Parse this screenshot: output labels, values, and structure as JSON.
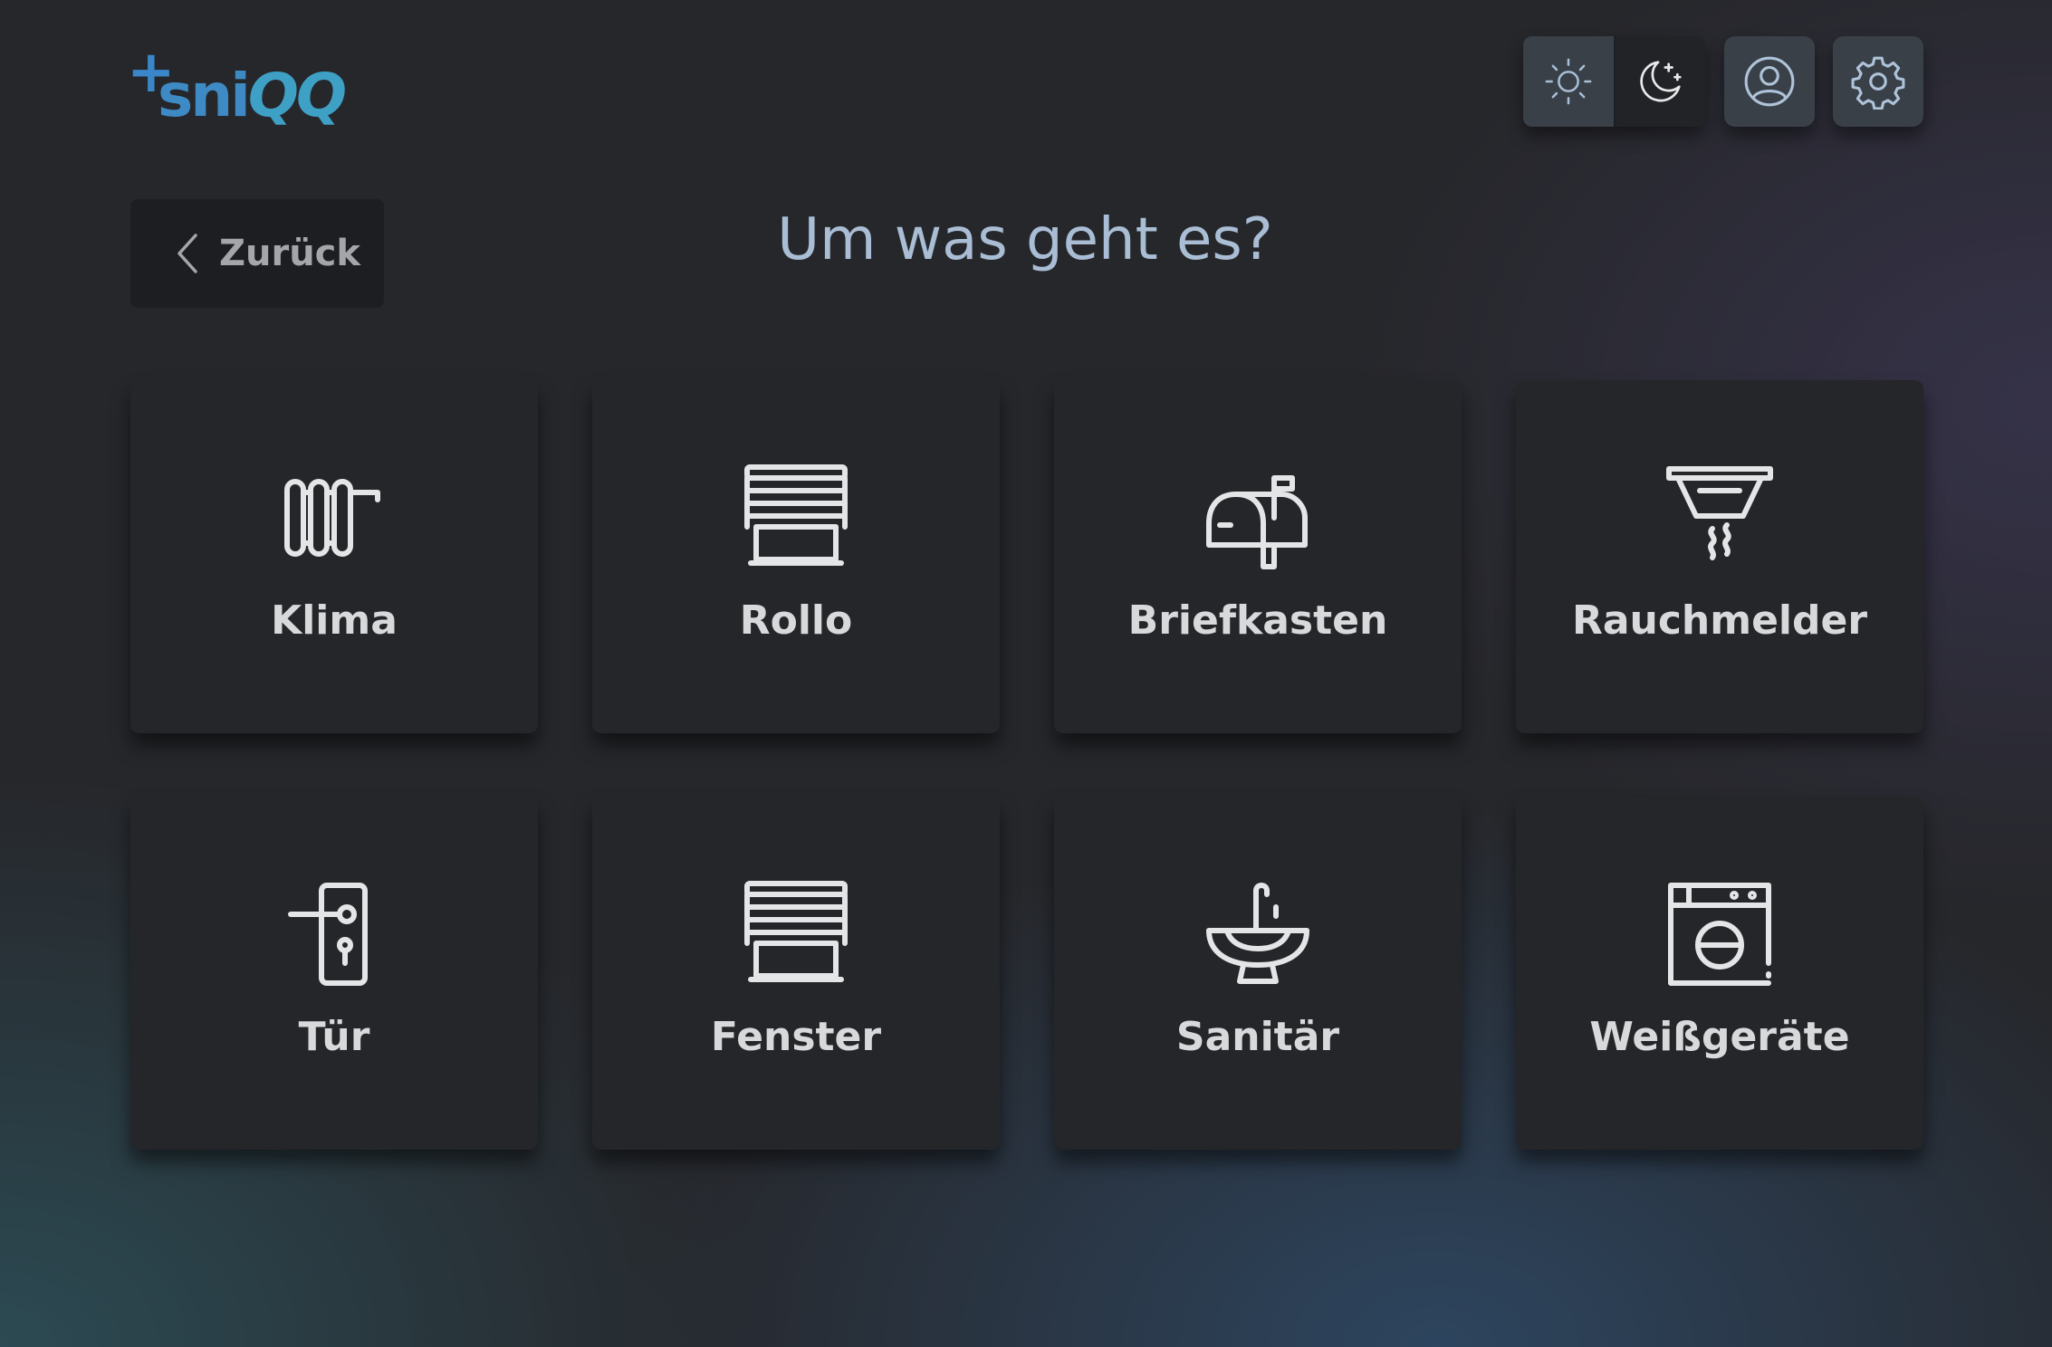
{
  "header": {
    "logo_text": "sniQQ",
    "theme": {
      "light_icon": "sun-icon",
      "dark_icon": "moon-stars-icon",
      "selected": "dark"
    },
    "profile_icon": "user-circle-icon",
    "settings_icon": "gear-icon"
  },
  "back_button": {
    "label": "Zurück",
    "icon": "chevron-left-icon"
  },
  "title": "Um was geht es?",
  "categories": [
    {
      "label": "Klima",
      "icon": "radiator-icon"
    },
    {
      "label": "Rollo",
      "icon": "roller-blind-icon"
    },
    {
      "label": "Briefkasten",
      "icon": "mailbox-icon"
    },
    {
      "label": "Rauchmelder",
      "icon": "smoke-detector-icon"
    },
    {
      "label": "Tür",
      "icon": "door-handle-icon"
    },
    {
      "label": "Fenster",
      "icon": "window-blind-icon"
    },
    {
      "label": "Sanitär",
      "icon": "sink-icon"
    },
    {
      "label": "Weißgeräte",
      "icon": "washing-machine-icon"
    }
  ],
  "colors": {
    "background": "#26272b",
    "tile": "#252629",
    "title": "#a9bdd4",
    "logo": "#3d8ac4"
  }
}
